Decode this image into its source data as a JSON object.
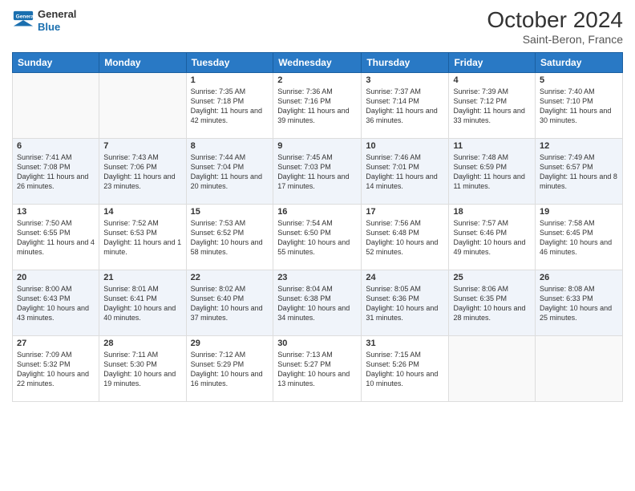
{
  "logo": {
    "general": "General",
    "blue": "Blue"
  },
  "title": "October 2024",
  "location": "Saint-Beron, France",
  "days_of_week": [
    "Sunday",
    "Monday",
    "Tuesday",
    "Wednesday",
    "Thursday",
    "Friday",
    "Saturday"
  ],
  "weeks": [
    [
      {
        "num": "",
        "sunrise": "",
        "sunset": "",
        "daylight": ""
      },
      {
        "num": "",
        "sunrise": "",
        "sunset": "",
        "daylight": ""
      },
      {
        "num": "1",
        "sunrise": "Sunrise: 7:35 AM",
        "sunset": "Sunset: 7:18 PM",
        "daylight": "Daylight: 11 hours and 42 minutes."
      },
      {
        "num": "2",
        "sunrise": "Sunrise: 7:36 AM",
        "sunset": "Sunset: 7:16 PM",
        "daylight": "Daylight: 11 hours and 39 minutes."
      },
      {
        "num": "3",
        "sunrise": "Sunrise: 7:37 AM",
        "sunset": "Sunset: 7:14 PM",
        "daylight": "Daylight: 11 hours and 36 minutes."
      },
      {
        "num": "4",
        "sunrise": "Sunrise: 7:39 AM",
        "sunset": "Sunset: 7:12 PM",
        "daylight": "Daylight: 11 hours and 33 minutes."
      },
      {
        "num": "5",
        "sunrise": "Sunrise: 7:40 AM",
        "sunset": "Sunset: 7:10 PM",
        "daylight": "Daylight: 11 hours and 30 minutes."
      }
    ],
    [
      {
        "num": "6",
        "sunrise": "Sunrise: 7:41 AM",
        "sunset": "Sunset: 7:08 PM",
        "daylight": "Daylight: 11 hours and 26 minutes."
      },
      {
        "num": "7",
        "sunrise": "Sunrise: 7:43 AM",
        "sunset": "Sunset: 7:06 PM",
        "daylight": "Daylight: 11 hours and 23 minutes."
      },
      {
        "num": "8",
        "sunrise": "Sunrise: 7:44 AM",
        "sunset": "Sunset: 7:04 PM",
        "daylight": "Daylight: 11 hours and 20 minutes."
      },
      {
        "num": "9",
        "sunrise": "Sunrise: 7:45 AM",
        "sunset": "Sunset: 7:03 PM",
        "daylight": "Daylight: 11 hours and 17 minutes."
      },
      {
        "num": "10",
        "sunrise": "Sunrise: 7:46 AM",
        "sunset": "Sunset: 7:01 PM",
        "daylight": "Daylight: 11 hours and 14 minutes."
      },
      {
        "num": "11",
        "sunrise": "Sunrise: 7:48 AM",
        "sunset": "Sunset: 6:59 PM",
        "daylight": "Daylight: 11 hours and 11 minutes."
      },
      {
        "num": "12",
        "sunrise": "Sunrise: 7:49 AM",
        "sunset": "Sunset: 6:57 PM",
        "daylight": "Daylight: 11 hours and 8 minutes."
      }
    ],
    [
      {
        "num": "13",
        "sunrise": "Sunrise: 7:50 AM",
        "sunset": "Sunset: 6:55 PM",
        "daylight": "Daylight: 11 hours and 4 minutes."
      },
      {
        "num": "14",
        "sunrise": "Sunrise: 7:52 AM",
        "sunset": "Sunset: 6:53 PM",
        "daylight": "Daylight: 11 hours and 1 minute."
      },
      {
        "num": "15",
        "sunrise": "Sunrise: 7:53 AM",
        "sunset": "Sunset: 6:52 PM",
        "daylight": "Daylight: 10 hours and 58 minutes."
      },
      {
        "num": "16",
        "sunrise": "Sunrise: 7:54 AM",
        "sunset": "Sunset: 6:50 PM",
        "daylight": "Daylight: 10 hours and 55 minutes."
      },
      {
        "num": "17",
        "sunrise": "Sunrise: 7:56 AM",
        "sunset": "Sunset: 6:48 PM",
        "daylight": "Daylight: 10 hours and 52 minutes."
      },
      {
        "num": "18",
        "sunrise": "Sunrise: 7:57 AM",
        "sunset": "Sunset: 6:46 PM",
        "daylight": "Daylight: 10 hours and 49 minutes."
      },
      {
        "num": "19",
        "sunrise": "Sunrise: 7:58 AM",
        "sunset": "Sunset: 6:45 PM",
        "daylight": "Daylight: 10 hours and 46 minutes."
      }
    ],
    [
      {
        "num": "20",
        "sunrise": "Sunrise: 8:00 AM",
        "sunset": "Sunset: 6:43 PM",
        "daylight": "Daylight: 10 hours and 43 minutes."
      },
      {
        "num": "21",
        "sunrise": "Sunrise: 8:01 AM",
        "sunset": "Sunset: 6:41 PM",
        "daylight": "Daylight: 10 hours and 40 minutes."
      },
      {
        "num": "22",
        "sunrise": "Sunrise: 8:02 AM",
        "sunset": "Sunset: 6:40 PM",
        "daylight": "Daylight: 10 hours and 37 minutes."
      },
      {
        "num": "23",
        "sunrise": "Sunrise: 8:04 AM",
        "sunset": "Sunset: 6:38 PM",
        "daylight": "Daylight: 10 hours and 34 minutes."
      },
      {
        "num": "24",
        "sunrise": "Sunrise: 8:05 AM",
        "sunset": "Sunset: 6:36 PM",
        "daylight": "Daylight: 10 hours and 31 minutes."
      },
      {
        "num": "25",
        "sunrise": "Sunrise: 8:06 AM",
        "sunset": "Sunset: 6:35 PM",
        "daylight": "Daylight: 10 hours and 28 minutes."
      },
      {
        "num": "26",
        "sunrise": "Sunrise: 8:08 AM",
        "sunset": "Sunset: 6:33 PM",
        "daylight": "Daylight: 10 hours and 25 minutes."
      }
    ],
    [
      {
        "num": "27",
        "sunrise": "Sunrise: 7:09 AM",
        "sunset": "Sunset: 5:32 PM",
        "daylight": "Daylight: 10 hours and 22 minutes."
      },
      {
        "num": "28",
        "sunrise": "Sunrise: 7:11 AM",
        "sunset": "Sunset: 5:30 PM",
        "daylight": "Daylight: 10 hours and 19 minutes."
      },
      {
        "num": "29",
        "sunrise": "Sunrise: 7:12 AM",
        "sunset": "Sunset: 5:29 PM",
        "daylight": "Daylight: 10 hours and 16 minutes."
      },
      {
        "num": "30",
        "sunrise": "Sunrise: 7:13 AM",
        "sunset": "Sunset: 5:27 PM",
        "daylight": "Daylight: 10 hours and 13 minutes."
      },
      {
        "num": "31",
        "sunrise": "Sunrise: 7:15 AM",
        "sunset": "Sunset: 5:26 PM",
        "daylight": "Daylight: 10 hours and 10 minutes."
      },
      {
        "num": "",
        "sunrise": "",
        "sunset": "",
        "daylight": ""
      },
      {
        "num": "",
        "sunrise": "",
        "sunset": "",
        "daylight": ""
      }
    ]
  ]
}
